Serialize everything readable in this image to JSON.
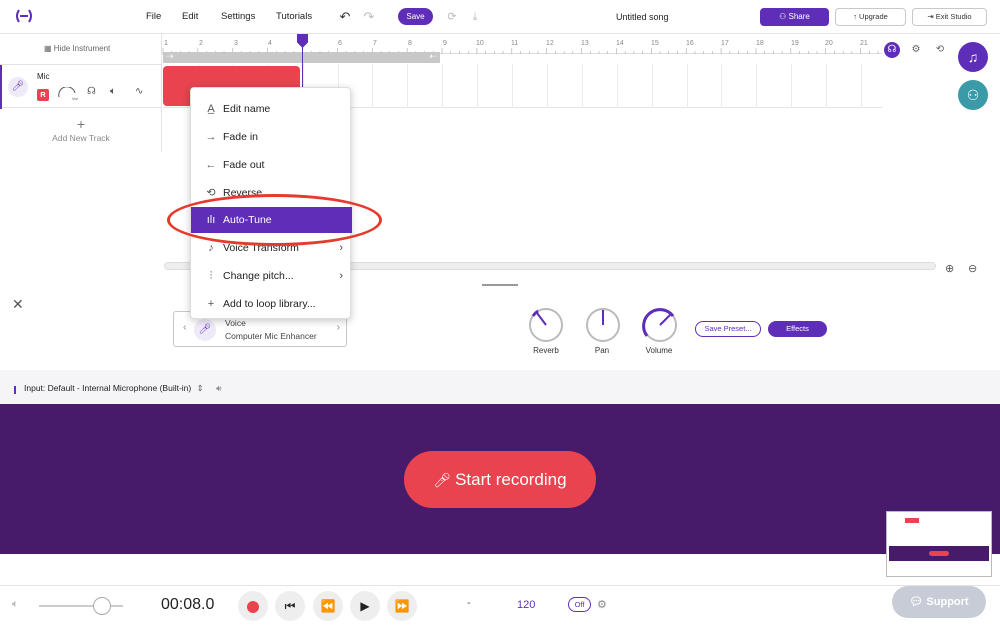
{
  "topbar": {
    "menus": [
      "File",
      "Edit",
      "Settings",
      "Tutorials"
    ],
    "save_label": "Save",
    "song_title": "Untitled song",
    "share_label": "Share",
    "upgrade_label": "Upgrade",
    "exit_label": "Exit Studio"
  },
  "tracks": {
    "hide_instrument_label": "Hide Instrument",
    "track_name": "Mic",
    "record_label": "R",
    "vol_label": "Vol",
    "add_track_label": "Add New Track"
  },
  "ruler": {
    "numbers": [
      "1",
      "2",
      "3",
      "4",
      "5",
      "6",
      "7",
      "8",
      "9",
      "10",
      "11",
      "12",
      "13",
      "14",
      "15",
      "16",
      "17",
      "18",
      "19",
      "20",
      "21"
    ]
  },
  "context_menu": {
    "items": [
      {
        "label": "Edit name",
        "icon": "text-cursor-icon"
      },
      {
        "label": "Fade in",
        "icon": "arrow-right-icon"
      },
      {
        "label": "Fade out",
        "icon": "arrow-left-icon"
      },
      {
        "label": "Reverse",
        "icon": "reverse-icon"
      },
      {
        "label": "Auto-Tune",
        "icon": "waveform-icon"
      },
      {
        "label": "Voice Transform",
        "icon": "voice-icon"
      },
      {
        "label": "Change pitch...",
        "icon": "sliders-icon"
      },
      {
        "label": "Add to loop library...",
        "icon": "plus-icon"
      }
    ],
    "highlighted": "Auto-Tune"
  },
  "effects": {
    "preset_line1": "Voice",
    "preset_line2": "Computer Mic Enhancer",
    "knobs": [
      "Reverb",
      "Pan",
      "Volume"
    ],
    "save_preset_label": "Save Preset...",
    "effects_label": "Effects",
    "input_label": "Input: Default - Internal Microphone (Built-in)"
  },
  "recording": {
    "start_label": "Start recording"
  },
  "transport": {
    "time": "00:08.0",
    "key_value": "-",
    "tempo": "120",
    "metronome_label": "Off",
    "support_label": "Support"
  },
  "colors": {
    "accent": "#5f2eb8",
    "record_red": "#e8434e",
    "rec_area_bg": "#481a6a",
    "teal_fab": "#3a9aa8"
  }
}
